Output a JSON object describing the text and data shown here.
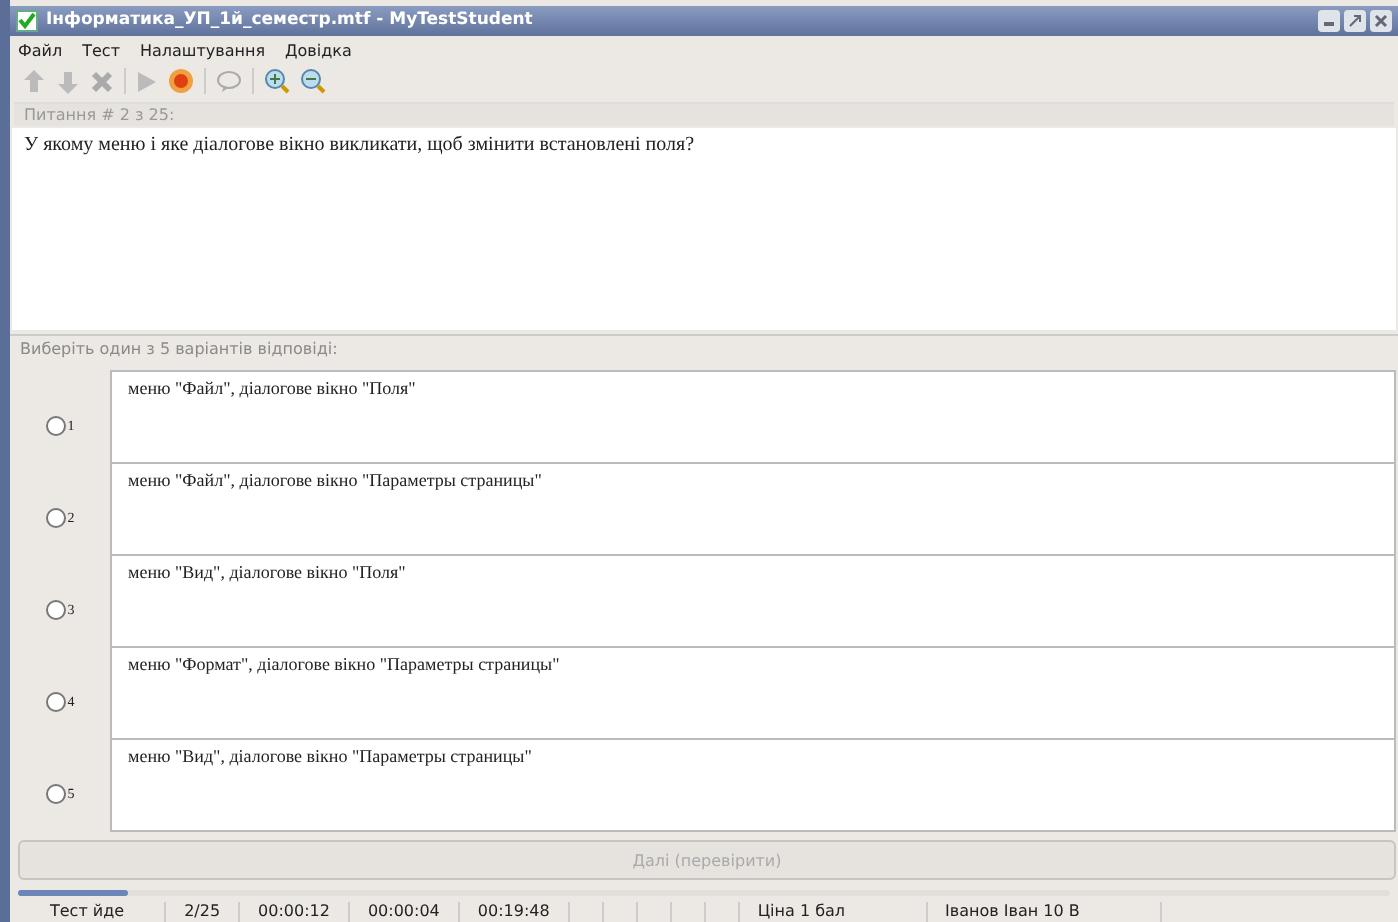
{
  "window": {
    "title": "Інформатика_УП_1й_семестр.mtf - MyTestStudent"
  },
  "menu": [
    "Файл",
    "Тест",
    "Налаштування",
    "Довідка"
  ],
  "question": {
    "header": "Питання # 2 з 25:",
    "text": "У якому меню і яке  діалогове вікно викликати, щоб змінити встановлені поля?"
  },
  "answers_header": "Виберіть один з 5 варіантів відповіді:",
  "answers": [
    {
      "number": "1",
      "text": "меню \"Файл\", діалогове вікно \"Поля\"",
      "selected": false
    },
    {
      "number": "2",
      "text": "меню \"Файл\", діалогове вікно \"Параметры страницы\"",
      "selected": false
    },
    {
      "number": "3",
      "text": "меню \"Вид\", діалогове вікно \"Поля\"",
      "selected": false
    },
    {
      "number": "4",
      "text": "меню \"Формат\", діалогове вікно \"Параметры страницы\"",
      "selected": false
    },
    {
      "number": "5",
      "text": "меню \"Вид\", діалогове вікно \"Параметры страницы\"",
      "selected": false
    }
  ],
  "next_button": {
    "label": "Далі (перевірити)",
    "disabled": true
  },
  "progress": {
    "level": 0.08
  },
  "status_bar": {
    "left": [
      "Тест йде",
      "2/25",
      "00:00:12",
      "00:00:04",
      "00:19:48"
    ],
    "right": [
      "Ціна 1 бал",
      "Іванов Іван 10 В"
    ]
  }
}
